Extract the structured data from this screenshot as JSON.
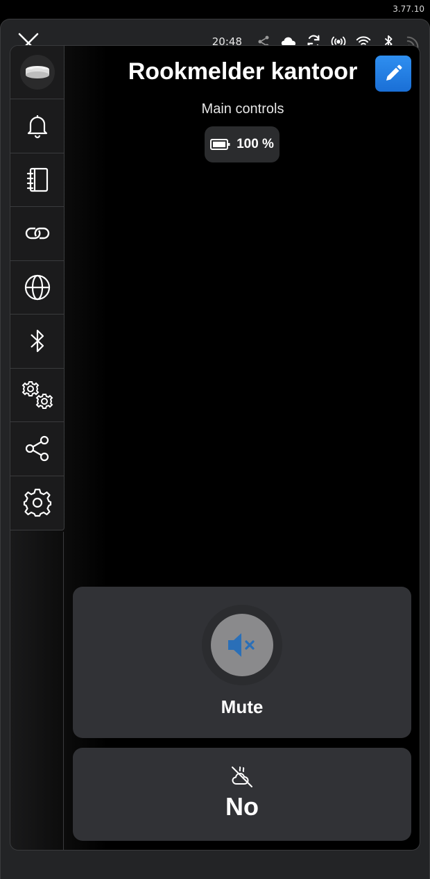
{
  "app": {
    "version": "3.77.10"
  },
  "statusbar": {
    "time": "20:48",
    "icons": [
      "share-icon",
      "cloud-icon",
      "sync-icon",
      "broadcast-icon",
      "wifi-icon",
      "bluetooth-icon",
      "rss-icon"
    ]
  },
  "sidebar": {
    "items": [
      {
        "name": "notifications",
        "icon": "bell-icon"
      },
      {
        "name": "logbook",
        "icon": "notebook-icon"
      },
      {
        "name": "links",
        "icon": "link-icon"
      },
      {
        "name": "network",
        "icon": "globe-icon"
      },
      {
        "name": "bluetooth",
        "icon": "bluetooth-icon"
      },
      {
        "name": "advanced-settings",
        "icon": "gears-icon"
      },
      {
        "name": "share",
        "icon": "share-icon"
      },
      {
        "name": "settings",
        "icon": "gear-icon"
      }
    ]
  },
  "device": {
    "title": "Rookmelder kantoor",
    "subtitle": "Main controls",
    "battery": "100 %"
  },
  "controls": {
    "mute_label": "Mute",
    "status_label": "No"
  },
  "colors": {
    "accent": "#1e7ae0",
    "card": "#313236",
    "mute_icon": "#2a6fb8"
  }
}
